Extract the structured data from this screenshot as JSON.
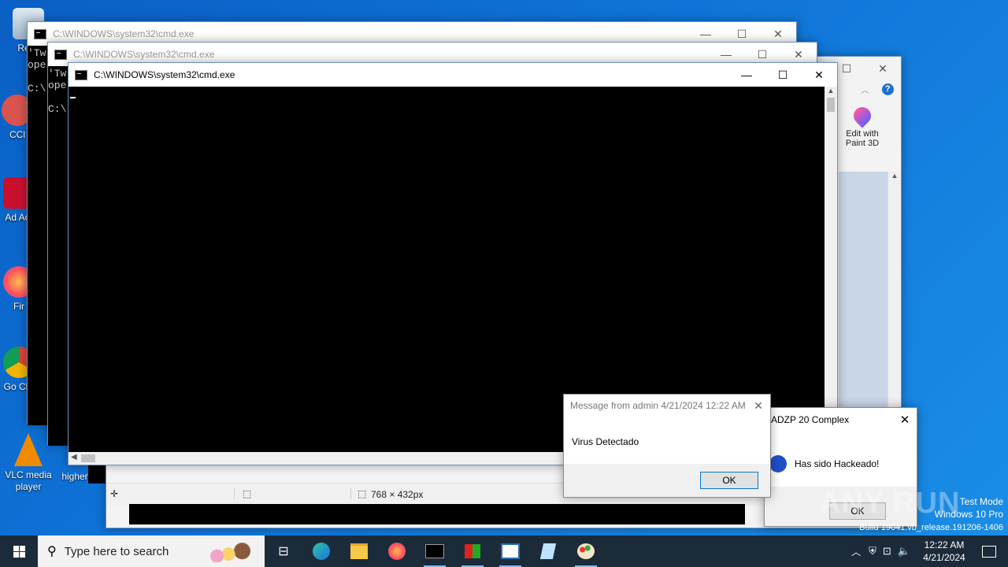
{
  "desktop": {
    "icons": [
      {
        "label": "Recy"
      },
      {
        "label": "CCl"
      },
      {
        "label": "Ad Acr"
      },
      {
        "label": "Fir"
      },
      {
        "label": "Go Chr"
      },
      {
        "label": "VLC media player"
      },
      {
        "label": "higher"
      }
    ]
  },
  "cmd_back": {
    "title": "C:\\WINDOWS\\system32\\cmd.exe",
    "lines": [
      "'Tw",
      "ope",
      "",
      "C:\\"
    ]
  },
  "cmd_mid": {
    "title": "C:\\WINDOWS\\system32\\cmd.exe",
    "lines": [
      "'Tw",
      "ope",
      "",
      "C:\\"
    ]
  },
  "cmd_front": {
    "title": "C:\\WINDOWS\\system32\\cmd.exe"
  },
  "paint": {
    "ribbon_button": "Edit with Paint 3D",
    "status_size": "768 × 432px"
  },
  "hack_dialog": {
    "title": "ADZP 20 Complex",
    "message": "Has sido Hackeado!",
    "ok": "OK"
  },
  "msg_dialog": {
    "title": "Message from admin 4/21/2024 12:22 AM",
    "message": "Virus Detectado",
    "ok": "OK"
  },
  "watermark": {
    "brand": "ANY RUN",
    "test_mode": "Test Mode",
    "edition": "Windows 10 Pro",
    "build": "Build 19041.vb_release.191206-1406"
  },
  "taskbar": {
    "search_placeholder": "Type here to search",
    "time": "12:22 AM",
    "date": "4/21/2024"
  }
}
